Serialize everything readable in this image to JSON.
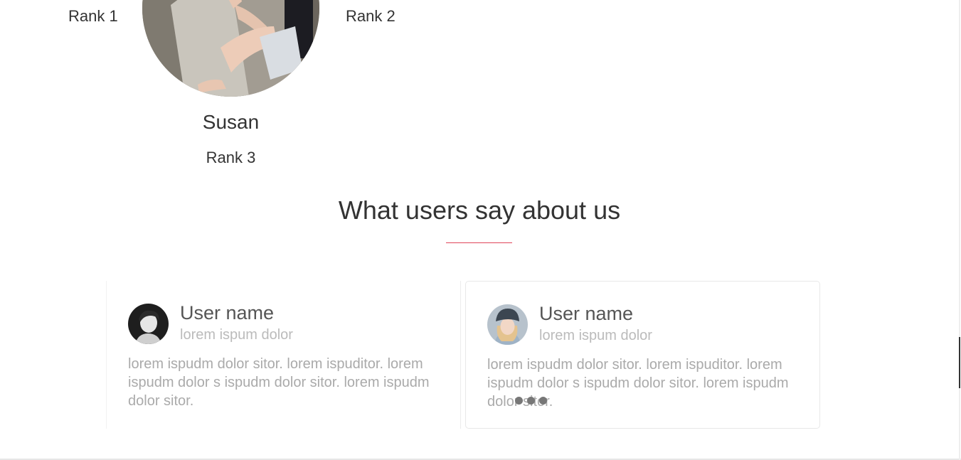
{
  "ranking": {
    "left_rank": "Rank 1",
    "right_rank": "Rank 2",
    "featured": {
      "name": "Susan",
      "rank": "Rank 3",
      "photo_icon": "person-sitting-photo"
    }
  },
  "testimonials": {
    "title": "What users say about us",
    "accent_color": "#e0455a",
    "cards": [
      {
        "name": "User name",
        "subtitle": "lorem ispum dolor",
        "quote": "lorem ispudm dolor sitor. lorem ispuditor. lorem ispudm dolor s ispudm dolor sitor. lorem ispudm dolor sitor.",
        "avatar_icon": "man-avatar"
      },
      {
        "name": "User name",
        "subtitle": "lorem ispum dolor",
        "quote": "lorem ispudm dolor sitor. lorem ispuditor. lorem ispudm dolor s ispudm dolor sitor. lorem ispudm dolor sitor.",
        "avatar_icon": "woman-avatar"
      }
    ],
    "carousel": {
      "dot_count": 3,
      "active_index": 1
    }
  }
}
